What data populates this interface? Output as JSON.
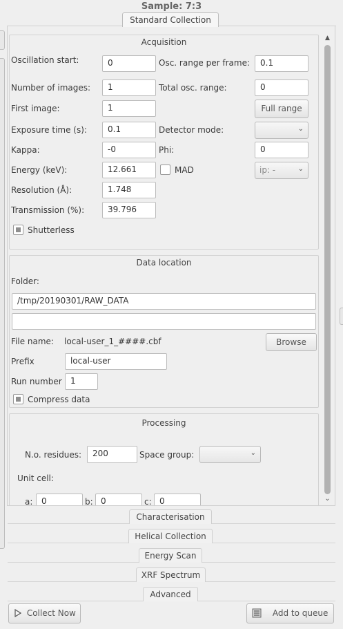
{
  "header": {
    "sample_label": "Sample: 7:3",
    "tab_standard": "Standard Collection"
  },
  "acquisition": {
    "title": "Acquisition",
    "osc_start_label": "Oscillation start:",
    "osc_start": "0",
    "osc_range_label": "Osc. range per frame:",
    "osc_range": "0.1",
    "num_images_label": "Number of images:",
    "num_images": "1",
    "total_osc_label": "Total osc. range:",
    "total_osc": "0",
    "first_image_label": "First image:",
    "first_image": "1",
    "full_range_label": "Full range",
    "exposure_label": "Exposure time (s):",
    "exposure": "0.1",
    "detector_mode_label": "Detector mode:",
    "detector_mode": "",
    "kappa_label": "Kappa:",
    "kappa": "-0",
    "phi_label": "Phi:",
    "phi": "0",
    "energy_label": "Energy (keV):",
    "energy": "12.661",
    "mad_label": "MAD",
    "mad_checked": false,
    "ip_value": "ip: -",
    "resolution_label": "Resolution (Å):",
    "resolution": "1.748",
    "transmission_label": "Transmission (%):",
    "transmission": "39.796",
    "shutterless_label": "Shutterless",
    "shutterless_checked": true
  },
  "data_location": {
    "title": "Data location",
    "folder_label": "Folder:",
    "folder": "/tmp/20190301/RAW_DATA",
    "folder2": "",
    "file_name_label": "File name:",
    "file_name": "local-user_1_####.cbf",
    "browse_label": "Browse",
    "prefix_label": "Prefix",
    "prefix": "local-user",
    "run_number_label": "Run number",
    "run_number": "1",
    "compress_label": "Compress data",
    "compress_checked": true
  },
  "processing": {
    "title": "Processing",
    "residues_label": "N.o. residues:",
    "residues": "200",
    "space_group_label": "Space group:",
    "space_group": "",
    "unit_cell_label": "Unit cell:",
    "a_label": "a:",
    "a": "0",
    "b_label": "b:",
    "b": "0",
    "c_label": "c:",
    "c": "0"
  },
  "tabs": {
    "characterisation": "Characterisation",
    "helical": "Helical Collection",
    "energy_scan": "Energy Scan",
    "xrf": "XRF Spectrum",
    "advanced": "Advanced"
  },
  "footer": {
    "collect_now": "Collect Now",
    "add_to_queue": "Add to queue"
  },
  "icons": {
    "collect_now_icon": "play-triangle-icon",
    "add_to_queue_icon": "queue-list-icon"
  }
}
